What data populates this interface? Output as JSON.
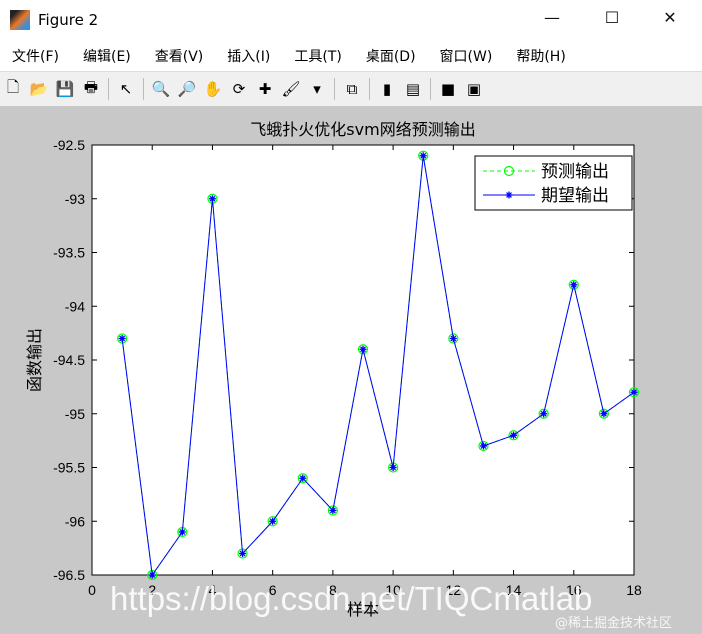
{
  "window": {
    "title": "Figure 2",
    "minimize": "—",
    "maximize": "☐",
    "close": "✕"
  },
  "menu": [
    "文件(F)",
    "编辑(E)",
    "查看(V)",
    "插入(I)",
    "工具(T)",
    "桌面(D)",
    "窗口(W)",
    "帮助(H)"
  ],
  "toolbar": [
    {
      "icon": "new-file-icon",
      "glyph": "🗋"
    },
    {
      "icon": "open-folder-icon",
      "glyph": "📂"
    },
    {
      "icon": "save-icon",
      "glyph": "💾"
    },
    {
      "icon": "print-icon",
      "glyph": "🖶"
    },
    {
      "sep": true
    },
    {
      "icon": "pointer-icon",
      "glyph": "↖"
    },
    {
      "sep": true
    },
    {
      "icon": "zoom-in-icon",
      "glyph": "🔍"
    },
    {
      "icon": "zoom-out-icon",
      "glyph": "🔎"
    },
    {
      "icon": "pan-hand-icon",
      "glyph": "✋"
    },
    {
      "icon": "rotate-3d-icon",
      "glyph": "⟳"
    },
    {
      "icon": "data-cursor-icon",
      "glyph": "✚"
    },
    {
      "icon": "brush-icon",
      "glyph": "🖌"
    },
    {
      "icon": "dropdown-arrow-icon",
      "glyph": "▾"
    },
    {
      "sep": true
    },
    {
      "icon": "link-plot-icon",
      "glyph": "⧉"
    },
    {
      "sep": true
    },
    {
      "icon": "colorbar-icon",
      "glyph": "▮"
    },
    {
      "icon": "legend-icon",
      "glyph": "▤"
    },
    {
      "sep": true
    },
    {
      "icon": "hide-plot-tools-icon",
      "glyph": "■"
    },
    {
      "icon": "show-plot-tools-icon",
      "glyph": "▣"
    }
  ],
  "watermark": "https://blog.csdn.net/TIQCmatlab",
  "watermark2": "@稀土掘金技术社区",
  "chart_data": {
    "type": "line",
    "title": "飞蛾扑火优化svm网络预测输出",
    "xlabel": "样本",
    "ylabel": "函数输出",
    "xlim": [
      0,
      18
    ],
    "ylim": [
      -96.5,
      -92.5
    ],
    "xticks": [
      0,
      2,
      4,
      6,
      8,
      10,
      12,
      14,
      16,
      18
    ],
    "yticks": [
      -92.5,
      -93,
      -93.5,
      -94,
      -94.5,
      -95,
      -95.5,
      -96,
      -96.5
    ],
    "grid": false,
    "legend_position": "top-right",
    "x": [
      1,
      2,
      3,
      4,
      5,
      6,
      7,
      8,
      9,
      10,
      11,
      12,
      13,
      14,
      15,
      16,
      17,
      18
    ],
    "series": [
      {
        "name": "预测输出",
        "color": "#00ff00",
        "style": "dashed",
        "marker": "circle",
        "values": [
          -94.3,
          -96.5,
          -96.1,
          -93.0,
          -96.3,
          -96.0,
          -95.6,
          -95.9,
          -94.4,
          -95.5,
          -92.6,
          -94.3,
          -95.3,
          -95.2,
          -95.0,
          -93.8,
          -95.0,
          -94.8
        ]
      },
      {
        "name": "期望输出",
        "color": "#0000ff",
        "style": "solid",
        "marker": "star",
        "values": [
          -94.3,
          -96.5,
          -96.1,
          -93.0,
          -96.3,
          -96.0,
          -95.6,
          -95.9,
          -94.4,
          -95.5,
          -92.6,
          -94.3,
          -95.3,
          -95.2,
          -95.0,
          -93.8,
          -95.0,
          -94.8
        ]
      }
    ]
  }
}
